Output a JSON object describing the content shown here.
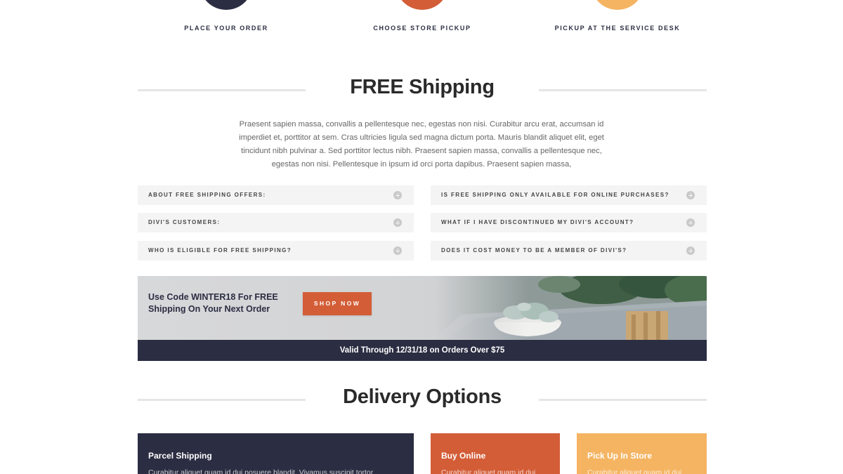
{
  "steps": [
    {
      "label": "Place Your Order",
      "color": "#2b2d42"
    },
    {
      "label": "Choose Store Pickup",
      "color": "#d35d37"
    },
    {
      "label": "Pickup At The Service Desk",
      "color": "#f5b462"
    }
  ],
  "free_shipping": {
    "title": "FREE Shipping",
    "intro": "Praesent sapien massa, convallis a pellentesque nec, egestas non nisi. Curabitur arcu erat, accumsan id imperdiet et, porttitor at sem. Cras ultricies ligula sed magna dictum porta. Mauris blandit aliquet elit, eget tincidunt nibh pulvinar a. Sed porttitor lectus nibh. Praesent sapien massa, convallis a pellentesque nec, egestas non nisi. Pellentesque in ipsum id orci porta dapibus. Praesent sapien massa,"
  },
  "faq": {
    "left": [
      {
        "label": "About Free Shipping Offers:"
      },
      {
        "label": "Divi's Customers:"
      },
      {
        "label": "Who Is Eligible For Free Shipping?"
      }
    ],
    "right": [
      {
        "label": "Is Free Shipping Only Available For Online Purchases?"
      },
      {
        "label": "What If I Have Discontinued My Divi's Account?"
      },
      {
        "label": "Does It Cost Money To Be A Member Of Divi's?"
      }
    ]
  },
  "promo": {
    "text": "Use Code WINTER18 For FREE Shipping On Your Next Order",
    "button_label": "Shop Now",
    "valid_text": "Valid Through 12/31/18 on Orders Over $75"
  },
  "delivery": {
    "title": "Delivery Options",
    "cards": [
      {
        "title": "Parcel Shipping",
        "desc": "Curabitur aliquet quam id dui posuere blandit. Vivamus suscipit tortor",
        "color": "#2b2d42"
      },
      {
        "title": "Buy Online",
        "desc": "Curabitur aliquet quam id dui",
        "color": "#d35d37"
      },
      {
        "title": "Pick Up In Store",
        "desc": "Curabitur aliquet quam id dui",
        "color": "#f5b462"
      }
    ]
  }
}
